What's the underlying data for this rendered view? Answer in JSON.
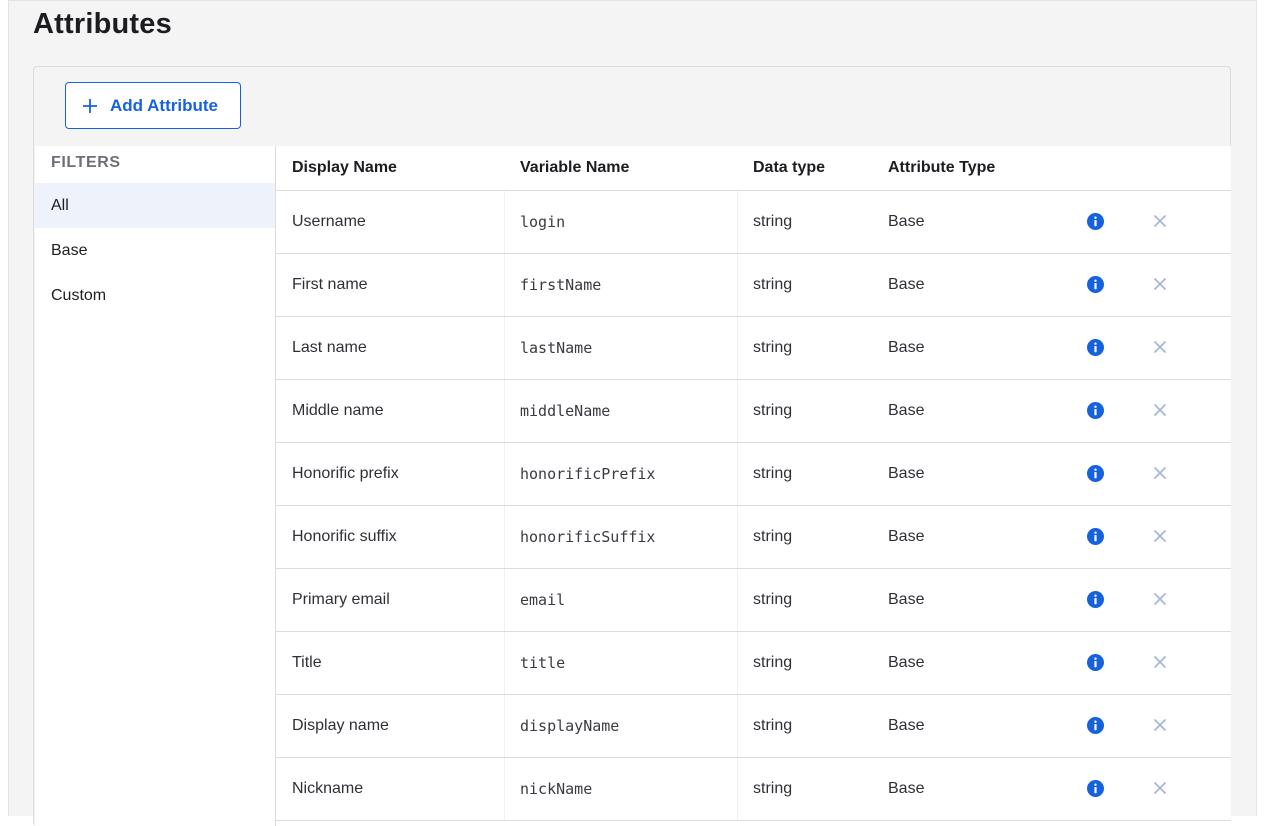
{
  "page": {
    "title": "Attributes"
  },
  "toolbar": {
    "add_label": "Add Attribute"
  },
  "filters": {
    "title": "FILTERS",
    "items": [
      {
        "label": "All",
        "active": true
      },
      {
        "label": "Base",
        "active": false
      },
      {
        "label": "Custom",
        "active": false
      }
    ]
  },
  "table": {
    "headers": [
      "Display Name",
      "Variable Name",
      "Data type",
      "Attribute Type"
    ],
    "rows": [
      {
        "display": "Username",
        "variable": "login",
        "type": "string",
        "attr": "Base"
      },
      {
        "display": "First name",
        "variable": "firstName",
        "type": "string",
        "attr": "Base"
      },
      {
        "display": "Last name",
        "variable": "lastName",
        "type": "string",
        "attr": "Base"
      },
      {
        "display": "Middle name",
        "variable": "middleName",
        "type": "string",
        "attr": "Base"
      },
      {
        "display": "Honorific prefix",
        "variable": "honorificPrefix",
        "type": "string",
        "attr": "Base"
      },
      {
        "display": "Honorific suffix",
        "variable": "honorificSuffix",
        "type": "string",
        "attr": "Base"
      },
      {
        "display": "Primary email",
        "variable": "email",
        "type": "string",
        "attr": "Base"
      },
      {
        "display": "Title",
        "variable": "title",
        "type": "string",
        "attr": "Base"
      },
      {
        "display": "Display name",
        "variable": "displayName",
        "type": "string",
        "attr": "Base"
      },
      {
        "display": "Nickname",
        "variable": "nickName",
        "type": "string",
        "attr": "Base"
      }
    ]
  },
  "colors": {
    "accent": "#1662dd",
    "close_icon": "#a9b6d6",
    "active_filter_bg": "#eef2fb"
  },
  "icons": {
    "add": "plus-icon",
    "info": "info-icon",
    "remove": "close-icon"
  }
}
